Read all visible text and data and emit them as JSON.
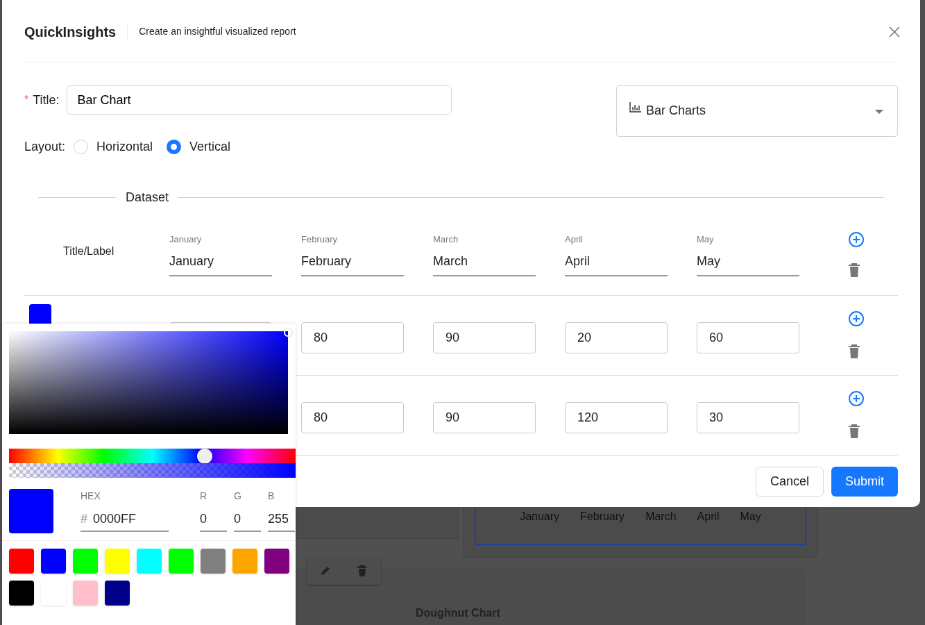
{
  "modal": {
    "title": "QuickInsights",
    "subtitle": "Create an insightful visualized report"
  },
  "form": {
    "required_mark": "*",
    "title_label": "Title",
    "title_colon": ":",
    "title_value": "Bar Chart",
    "chart_type": "Bar Charts",
    "layout_label": "Layout",
    "layout_colon": ":",
    "layout_options": [
      {
        "label": "Horizontal",
        "selected": false
      },
      {
        "label": "Vertical",
        "selected": true
      }
    ]
  },
  "dataset": {
    "heading": "Dataset",
    "label_column": "Title/Label",
    "columns": [
      {
        "label": "January",
        "value": "January"
      },
      {
        "label": "February",
        "value": "February"
      },
      {
        "label": "March",
        "value": "March"
      },
      {
        "label": "April",
        "value": "April"
      },
      {
        "label": "May",
        "value": "May"
      }
    ],
    "rows": [
      {
        "color": "#0000ff",
        "values": [
          "80",
          "90",
          "20",
          "60"
        ]
      },
      {
        "values": [
          "80",
          "90",
          "120",
          "30"
        ]
      }
    ]
  },
  "buttons": [
    {
      "label": "Cancel",
      "kind": "secondary"
    },
    {
      "label": "Submit",
      "kind": "primary"
    }
  ],
  "color_picker": {
    "color": "#0000ff",
    "hue": {
      "level": 0.684
    },
    "alpha": {
      "level": 1
    },
    "hex_label": "HEX",
    "hex_prefix": "#",
    "hex": "0000FF",
    "channels": [
      {
        "label": "R",
        "value": "0"
      },
      {
        "label": "G",
        "value": "0"
      },
      {
        "label": "B",
        "value": "255"
      }
    ],
    "presets": [
      {
        "color": "#ff0000"
      },
      {
        "color": "#0000ff"
      },
      {
        "color": "#00ff00"
      },
      {
        "color": "#ffff00"
      },
      {
        "color": "#00ffff"
      },
      {
        "color": "#00ff00"
      },
      {
        "color": "#808080"
      },
      {
        "color": "#ffa500"
      },
      {
        "color": "#800080"
      },
      {
        "color": "#000000"
      },
      {
        "color": "#ffffff"
      },
      {
        "color": "#ffc0cb"
      },
      {
        "color": "#00008b"
      }
    ]
  },
  "background": {
    "axis_labels": [
      "January",
      "February",
      "March",
      "April",
      "May"
    ],
    "doughnut_title": "Doughnut Chart"
  }
}
